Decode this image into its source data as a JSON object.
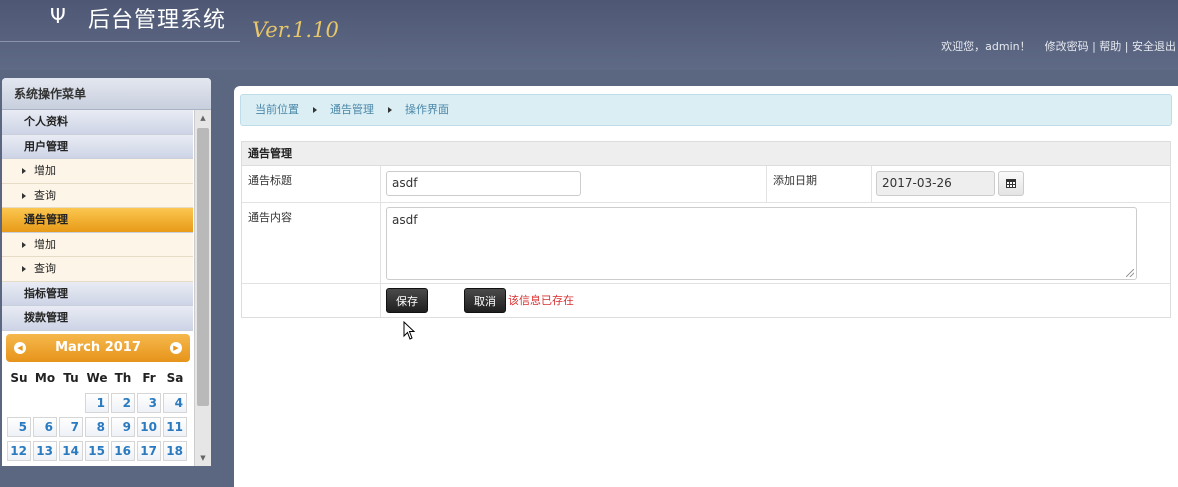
{
  "header": {
    "logo_glyph": "Ψ",
    "title": "后台管理系统",
    "version": "Ver.1.10",
    "welcome": "欢迎您，admin！",
    "links": [
      "修改密码",
      "帮助",
      "安全退出"
    ]
  },
  "sidebar": {
    "title": "系统操作菜单",
    "items": [
      {
        "label": "个人资料",
        "type": "group"
      },
      {
        "label": "用户管理",
        "type": "group"
      },
      {
        "label": "增加",
        "type": "sub"
      },
      {
        "label": "查询",
        "type": "sub"
      },
      {
        "label": "通告管理",
        "type": "group",
        "active": true
      },
      {
        "label": "增加",
        "type": "sub"
      },
      {
        "label": "查询",
        "type": "sub"
      },
      {
        "label": "指标管理",
        "type": "group"
      },
      {
        "label": "拨款管理",
        "type": "group"
      }
    ]
  },
  "calendar": {
    "month_label": "March 2017",
    "weekdays": [
      "Su",
      "Mo",
      "Tu",
      "We",
      "Th",
      "Fr",
      "Sa"
    ],
    "leading_blanks": 3,
    "days": [
      "1",
      "2",
      "3",
      "4",
      "5",
      "6",
      "7",
      "8",
      "9",
      "10",
      "11",
      "12",
      "13",
      "14",
      "15",
      "16",
      "17",
      "18"
    ]
  },
  "breadcrumb": {
    "items": [
      "当前位置",
      "通告管理",
      "操作界面"
    ]
  },
  "form": {
    "section_title": "通告管理",
    "title_label": "通告标题",
    "title_value": "asdf",
    "date_label": "添加日期",
    "date_value": "2017-03-26",
    "content_label": "通告内容",
    "content_value": "asdf",
    "save_label": "保存",
    "cancel_label": "取消",
    "message": "该信息已存在"
  },
  "colors": {
    "accent_orange": "#e89a17",
    "error_red": "#d83030",
    "breadcrumb_bg": "#dbeef4"
  }
}
